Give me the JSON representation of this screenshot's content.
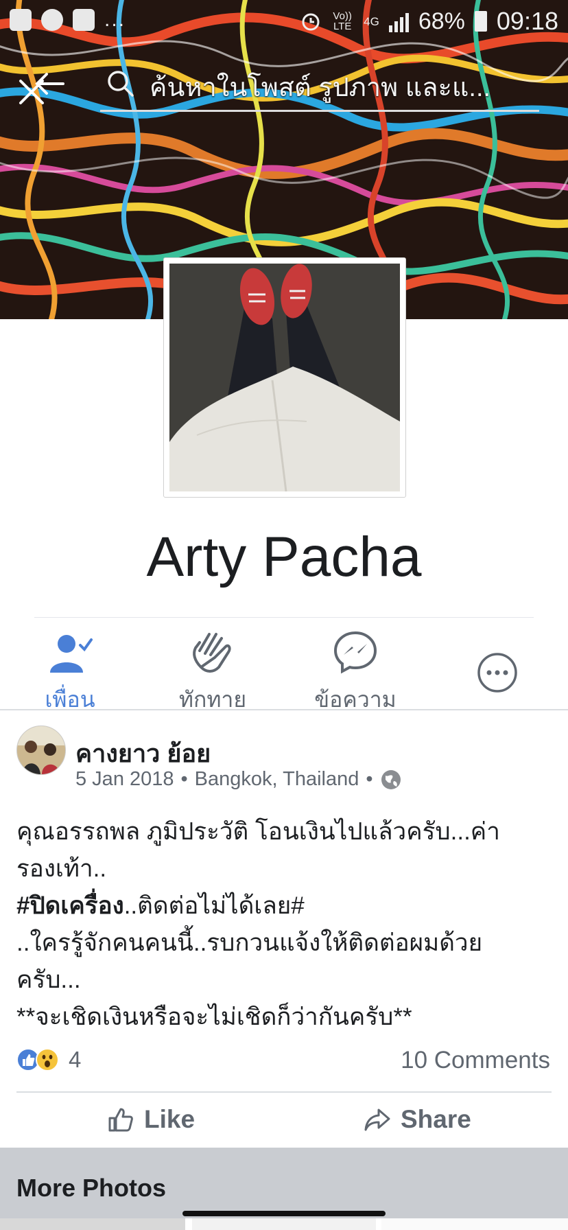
{
  "statusbar": {
    "network_label": "Vo)) LTE",
    "network_type": "4G",
    "battery": "68%",
    "time": "09:18",
    "app_icons": [
      "image-icon",
      "line-icon",
      "facebook-icon"
    ],
    "more": "..."
  },
  "search": {
    "placeholder": "ค้นหาในโพสต์ รูปภาพ และแ..."
  },
  "profile": {
    "name": "Arty Pacha"
  },
  "actions": [
    {
      "label": "เพื่อน",
      "icon": "friends-icon",
      "active": true
    },
    {
      "label": "ทักทาย",
      "icon": "wave-icon",
      "active": false
    },
    {
      "label": "ข้อความ",
      "icon": "messenger-icon",
      "active": false
    },
    {
      "label": "",
      "icon": "more-icon",
      "active": false
    }
  ],
  "post": {
    "author": "คางยาว ย้อย",
    "date": "5 Jan 2018",
    "location": "Bangkok, Thailand",
    "separator": "•",
    "text_lines": [
      "คุณอรรถพล ภูมิประวัติ โอนเงินไปแล้วครับ...ค่า",
      "รองเท้า..",
      "..ติดต่อไม่ได้เลย#",
      "..ใครรู้จักคนคนนี้..รบกวนแจ้งให้ติดต่อผมด้วย",
      "ครับ...",
      "**จะเชิดเงินหรือจะไม่เชิดก็ว่ากันครับ**"
    ],
    "bold_hashtag": "#ปิดเครื่อง",
    "reaction_count": "4",
    "comments": "10 Comments",
    "like_label": "Like",
    "share_label": "Share"
  },
  "more_photos": {
    "title": "More Photos"
  },
  "colors": {
    "accent": "#4a7fd6",
    "muted": "#606770",
    "divider": "#dadde1"
  }
}
